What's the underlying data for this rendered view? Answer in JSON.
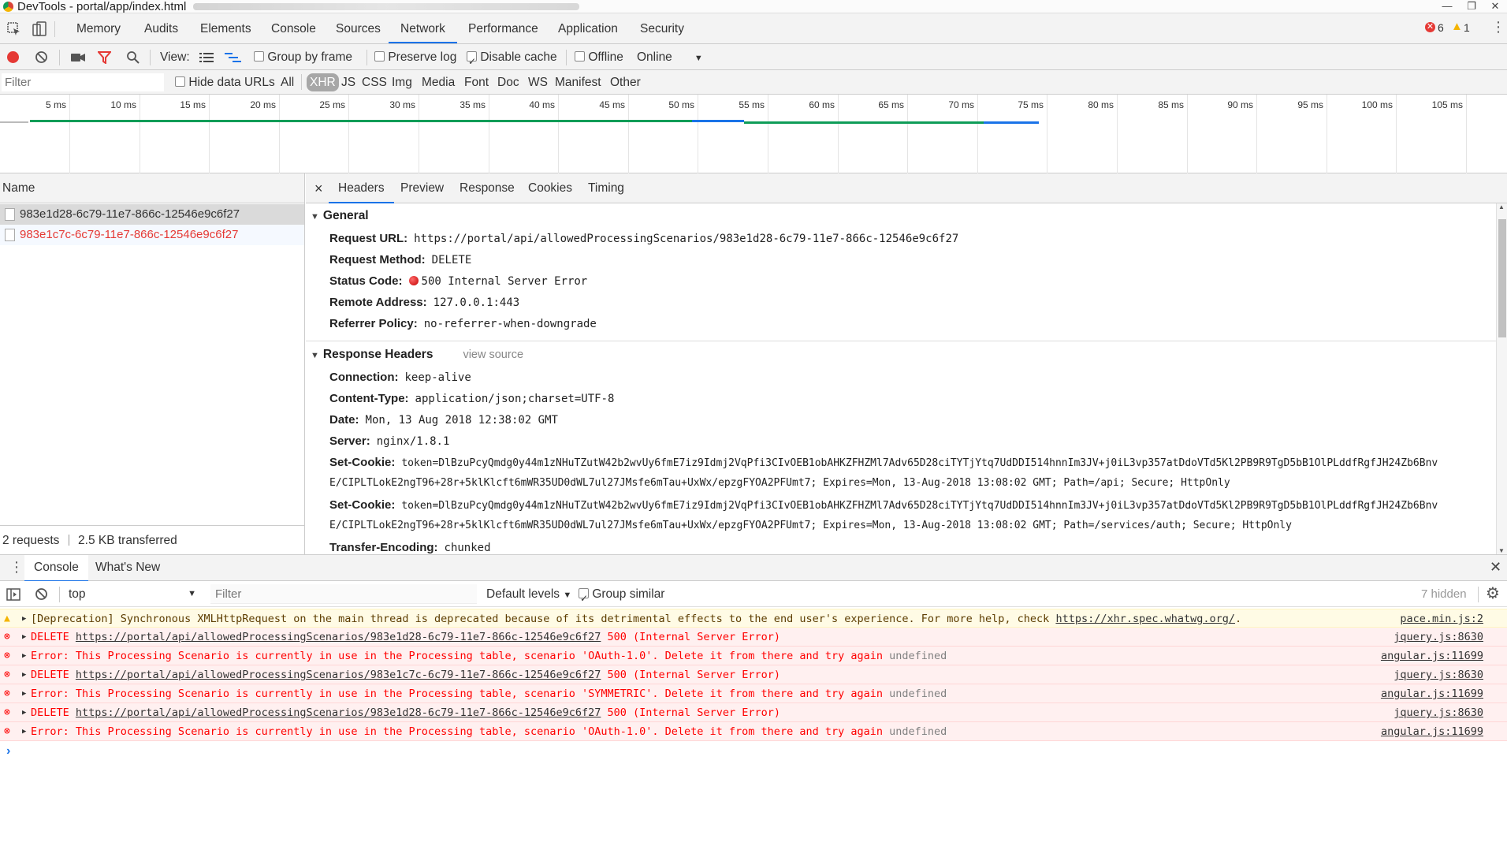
{
  "window": {
    "title": "DevTools - portal/app/index.html",
    "buttons": [
      "—",
      "❐",
      "✕"
    ]
  },
  "tabs": [
    {
      "label": "Memory"
    },
    {
      "label": "Audits"
    },
    {
      "label": "Elements"
    },
    {
      "label": "Console"
    },
    {
      "label": "Sources"
    },
    {
      "label": "Network",
      "active": true
    },
    {
      "label": "Performance"
    },
    {
      "label": "Application"
    },
    {
      "label": "Security"
    }
  ],
  "badges": {
    "errors": "6",
    "warnings": "1"
  },
  "toolbar": {
    "view_label": "View:",
    "group_by_frame": "Group by frame",
    "preserve_log": "Preserve log",
    "disable_cache": "Disable cache",
    "offline": "Offline",
    "throttle": "Online"
  },
  "filter": {
    "placeholder": "Filter",
    "hide_data_urls": "Hide data URLs",
    "types": [
      "All",
      "XHR",
      "JS",
      "CSS",
      "Img",
      "Media",
      "Font",
      "Doc",
      "WS",
      "Manifest",
      "Other"
    ],
    "selected": "XHR"
  },
  "timeline": {
    "ticks": [
      "5 ms",
      "10 ms",
      "15 ms",
      "20 ms",
      "25 ms",
      "30 ms",
      "35 ms",
      "40 ms",
      "45 ms",
      "50 ms",
      "55 ms",
      "60 ms",
      "65 ms",
      "70 ms",
      "75 ms",
      "80 ms",
      "85 ms",
      "90 ms",
      "95 ms",
      "100 ms",
      "105 ms",
      "1"
    ]
  },
  "requests": {
    "header": "Name",
    "items": [
      {
        "name": "983e1d28-6c79-11e7-866c-12546e9c6f27"
      },
      {
        "name": "983e1c7c-6c79-11e7-866c-12546e9c6f27"
      }
    ],
    "summary": "2 requests",
    "transferred": "2.5 KB transferred"
  },
  "details": {
    "tabs": [
      "Headers",
      "Preview",
      "Response",
      "Cookies",
      "Timing"
    ],
    "close": "×",
    "general_title": "General",
    "general": [
      {
        "key": "Request URL:",
        "value": "https://portal/api/allowedProcessingScenarios/983e1d28-6c79-11e7-866c-12546e9c6f27"
      },
      {
        "key": "Request Method:",
        "value": "DELETE"
      },
      {
        "key": "Status Code:",
        "value": "500 Internal Server Error"
      },
      {
        "key": "Remote Address:",
        "value": "127.0.0.1:443"
      },
      {
        "key": "Referrer Policy:",
        "value": "no-referrer-when-downgrade"
      }
    ],
    "response_title": "Response Headers",
    "view_source": "view source",
    "response": [
      {
        "key": "Connection:",
        "value": "keep-alive"
      },
      {
        "key": "Content-Type:",
        "value": "application/json;charset=UTF-8"
      },
      {
        "key": "Date:",
        "value": "Mon, 13 Aug 2018 12:38:02 GMT"
      },
      {
        "key": "Server:",
        "value": "nginx/1.8.1"
      },
      {
        "key": "Set-Cookie:",
        "value": "token=DlBzuPcyQmdg0y44m1zNHuTZutW42b2wvUy6fmE7iz9Idmj2VqPfi3CIvOEB1obAHKZFHZMl7Adv65D28ciTYTjYtq7UdDDI514hnnIm3JV+j0iL3vp357atDdoVTd5Kl2PB9R9TgD5bB1OlPLddfRgfJH24Zb6Bnv",
        "cont": "E/CIPLTLokE2ngT96+28r+5klKlcft6mWR35UD0dWL7ul27JMsfe6mTau+UxWx/epzgFYOA2PFUmt7; Expires=Mon, 13-Aug-2018 13:08:02 GMT; Path=/api; Secure; HttpOnly"
      },
      {
        "key": "Set-Cookie:",
        "value": "token=DlBzuPcyQmdg0y44m1zNHuTZutW42b2wvUy6fmE7iz9Idmj2VqPfi3CIvOEB1obAHKZFHZMl7Adv65D28ciTYTjYtq7UdDDI514hnnIm3JV+j0iL3vp357atDdoVTd5Kl2PB9R9TgD5bB1OlPLddfRgfJH24Zb6Bnv",
        "cont": "E/CIPLTLokE2ngT96+28r+5klKlcft6mWR35UD0dWL7ul27JMsfe6mTau+UxWx/epzgFYOA2PFUmt7; Expires=Mon, 13-Aug-2018 13:08:02 GMT; Path=/services/auth; Secure; HttpOnly"
      },
      {
        "key": "Transfer-Encoding:",
        "value": "chunked"
      }
    ]
  },
  "drawer": {
    "tabs": [
      "Console",
      "What's New"
    ],
    "context": "top",
    "filter_placeholder": "Filter",
    "levels": "Default levels",
    "group_similar": "Group similar",
    "hidden": "7 hidden"
  },
  "console": [
    {
      "level": "warn",
      "text": "[Deprecation] Synchronous XMLHttpRequest on the main thread is deprecated because of its detrimental effects to the end user's experience. For more help, check ",
      "link": "https://xhr.spec.whatwg.org/",
      "tail": ".",
      "source": "pace.min.js:2"
    },
    {
      "level": "error",
      "prefix": "DELETE ",
      "link": "https://portal/api/allowedProcessingScenarios/983e1d28-6c79-11e7-866c-12546e9c6f27",
      "tail": " 500 (Internal Server Error)",
      "source": "jquery.js:8630"
    },
    {
      "level": "error",
      "text": "Error:  This Processing Scenario is currently in use in the Processing table, scenario 'OAuth-1.0'. Delete it from there and try again",
      "undef": " undefined",
      "source": "angular.js:11699"
    },
    {
      "level": "error",
      "prefix": "DELETE ",
      "link": "https://portal/api/allowedProcessingScenarios/983e1c7c-6c79-11e7-866c-12546e9c6f27",
      "tail": " 500 (Internal Server Error)",
      "source": "jquery.js:8630"
    },
    {
      "level": "error",
      "text": "Error:  This Processing Scenario is currently in use in the Processing table, scenario 'SYMMETRIC'. Delete it from there and try again",
      "undef": " undefined",
      "source": "angular.js:11699"
    },
    {
      "level": "error",
      "prefix": "DELETE ",
      "link": "https://portal/api/allowedProcessingScenarios/983e1d28-6c79-11e7-866c-12546e9c6f27",
      "tail": " 500 (Internal Server Error)",
      "source": "jquery.js:8630"
    },
    {
      "level": "error",
      "text": "Error:  This Processing Scenario is currently in use in the Processing table, scenario 'OAuth-1.0'. Delete it from there and try again",
      "undef": " undefined",
      "source": "angular.js:11699"
    }
  ],
  "prompt": "›",
  "colors": {
    "accent": "#1a73e8",
    "error": "#ff0000",
    "warning_bg": "#fffbe5",
    "error_bg": "#fff0f0"
  }
}
